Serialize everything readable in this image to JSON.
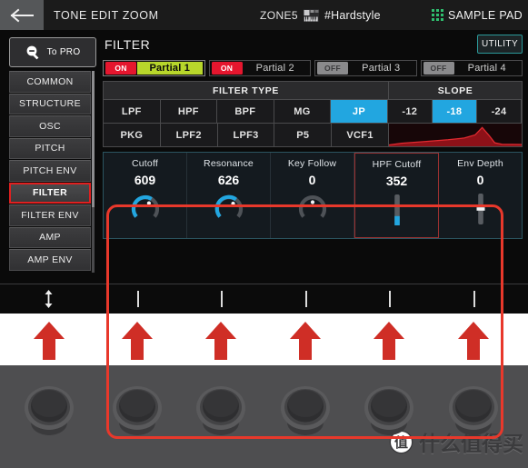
{
  "topbar": {
    "back_icon": "back-arrow-icon",
    "title": "TONE EDIT ZOOM",
    "zone": "ZONE5",
    "keyboard_icon": "keyboard-icon",
    "tone_name": "#Hardstyle",
    "pad_icon": "grid-icon",
    "pad_label": "SAMPLE PAD"
  },
  "sidebar": {
    "to_pro": {
      "icon": "zoom-out-icon",
      "label": "To PRO"
    },
    "items": [
      {
        "label": "COMMON",
        "active": false
      },
      {
        "label": "STRUCTURE",
        "active": false
      },
      {
        "label": "OSC",
        "active": false
      },
      {
        "label": "PITCH",
        "active": false
      },
      {
        "label": "PITCH ENV",
        "active": false
      },
      {
        "label": "FILTER",
        "active": true
      },
      {
        "label": "FILTER ENV",
        "active": false
      },
      {
        "label": "AMP",
        "active": false
      },
      {
        "label": "AMP ENV",
        "active": false
      }
    ],
    "resize_icon": "vertical-resize-icon"
  },
  "main": {
    "title": "FILTER",
    "utility_label": "UTILITY",
    "partials": [
      {
        "state": "ON",
        "label": "Partial 1",
        "selected": true
      },
      {
        "state": "ON",
        "label": "Partial 2",
        "selected": false
      },
      {
        "state": "OFF",
        "label": "Partial 3",
        "selected": false
      },
      {
        "state": "OFF",
        "label": "Partial 4",
        "selected": false
      }
    ],
    "filter_type_header": "FILTER TYPE",
    "slope_header": "SLOPE",
    "filter_types_row1": [
      {
        "label": "LPF",
        "selected": false
      },
      {
        "label": "HPF",
        "selected": false
      },
      {
        "label": "BPF",
        "selected": false
      },
      {
        "label": "MG",
        "selected": false
      },
      {
        "label": "JP",
        "selected": true
      }
    ],
    "filter_types_row2": [
      {
        "label": "PKG",
        "selected": false
      },
      {
        "label": "LPF2",
        "selected": false
      },
      {
        "label": "LPF3",
        "selected": false
      },
      {
        "label": "P5",
        "selected": false
      },
      {
        "label": "VCF1",
        "selected": false
      }
    ],
    "slopes": [
      {
        "label": "-12",
        "selected": false
      },
      {
        "label": "-18",
        "selected": true
      },
      {
        "label": "-24",
        "selected": false
      }
    ],
    "params": [
      {
        "name": "Cutoff",
        "value": "609",
        "control": "knob",
        "fill": 0.62,
        "boxed": false
      },
      {
        "name": "Resonance",
        "value": "626",
        "control": "knob",
        "fill": 0.64,
        "boxed": false
      },
      {
        "name": "Key Follow",
        "value": "0",
        "control": "knob",
        "fill": 0.0,
        "boxed": false
      },
      {
        "name": "HPF Cutoff",
        "value": "352",
        "control": "slider",
        "fill": 0.3,
        "boxed": true
      },
      {
        "name": "Env Depth",
        "value": "0",
        "control": "slider",
        "fill": 0.5,
        "boxed": false
      }
    ]
  },
  "colors": {
    "accent_blue": "#22a6e0",
    "partial_selected": "#b8d62b",
    "on_red": "#e5162e",
    "off_gray": "#8a8a8c",
    "callout_red": "#e8382b",
    "utility_border": "#2b9a9a",
    "curve_red": "#c8202a"
  },
  "watermark": {
    "badge": "值",
    "text": "什么值得买"
  },
  "knob_count": 6
}
